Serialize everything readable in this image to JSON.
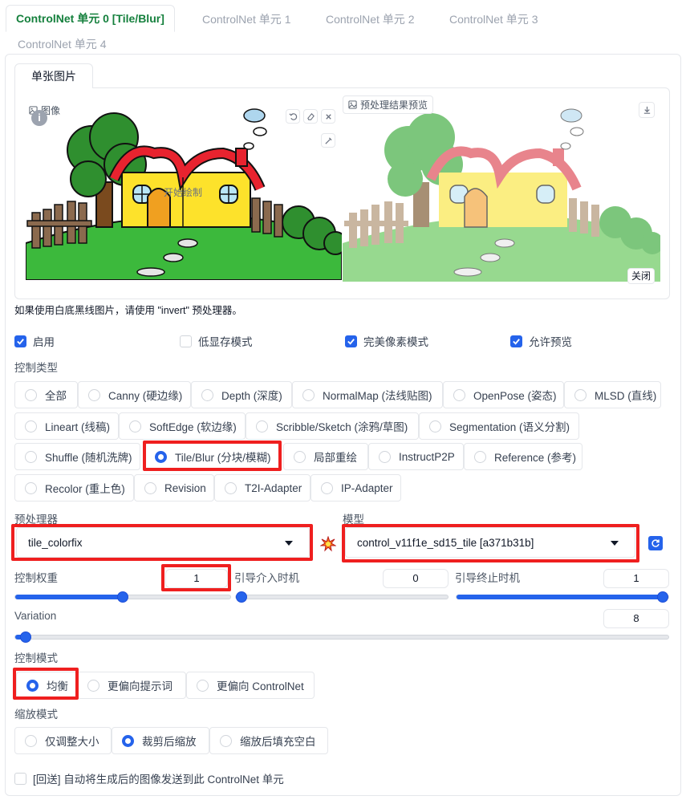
{
  "unit_tabs": [
    {
      "label": "ControlNet 单元 0 [Tile/Blur]",
      "active": true
    },
    {
      "label": "ControlNet 单元 1",
      "active": false
    },
    {
      "label": "ControlNet 单元 2",
      "active": false
    },
    {
      "label": "ControlNet 单元 3",
      "active": false
    },
    {
      "label": "ControlNet 单元 4",
      "active": false
    }
  ],
  "image_tab": "单张图片",
  "image_panel": {
    "input_label": "图像",
    "overlay_text": "开始绘制",
    "preview_label": "预处理结果预览",
    "close_label": "关闭"
  },
  "hint": "如果使用白底黑线图片，请使用 \"invert\" 预处理器。",
  "checkboxes": [
    {
      "label": "启用",
      "checked": true
    },
    {
      "label": "低显存模式",
      "checked": false
    },
    {
      "label": "完美像素模式",
      "checked": true
    },
    {
      "label": "允许预览",
      "checked": true
    }
  ],
  "control_type": {
    "label": "控制类型",
    "options": [
      {
        "label": "全部",
        "selected": false
      },
      {
        "label": "Canny (硬边缘)",
        "selected": false
      },
      {
        "label": "Depth (深度)",
        "selected": false
      },
      {
        "label": "NormalMap (法线贴图)",
        "selected": false
      },
      {
        "label": "OpenPose (姿态)",
        "selected": false
      },
      {
        "label": "MLSD (直线)",
        "selected": false
      },
      {
        "label": "Lineart (线稿)",
        "selected": false
      },
      {
        "label": "SoftEdge (软边缘)",
        "selected": false
      },
      {
        "label": "Scribble/Sketch (涂鸦/草图)",
        "selected": false
      },
      {
        "label": "Segmentation (语义分割)",
        "selected": false
      },
      {
        "label": "Shuffle (随机洗牌)",
        "selected": false
      },
      {
        "label": "Tile/Blur (分块/模糊)",
        "selected": true
      },
      {
        "label": "局部重绘",
        "selected": false
      },
      {
        "label": "InstructP2P",
        "selected": false
      },
      {
        "label": "Reference (参考)",
        "selected": false
      },
      {
        "label": "Recolor (重上色)",
        "selected": false
      },
      {
        "label": "Revision",
        "selected": false
      },
      {
        "label": "T2I-Adapter",
        "selected": false
      },
      {
        "label": "IP-Adapter",
        "selected": false
      }
    ]
  },
  "preprocessor": {
    "label": "预处理器",
    "value": "tile_colorfix"
  },
  "model": {
    "label": "模型",
    "value": "control_v11f1e_sd15_tile [a371b31b]"
  },
  "sliders": {
    "weight": {
      "label": "控制权重",
      "value": "1",
      "min": 0,
      "max": 2
    },
    "start": {
      "label": "引导介入时机",
      "value": "0",
      "min": 0,
      "max": 1
    },
    "end": {
      "label": "引导终止时机",
      "value": "1",
      "min": 0,
      "max": 1
    },
    "variation": {
      "label": "Variation",
      "value": "8",
      "min": 0,
      "max": 1000
    }
  },
  "control_mode": {
    "label": "控制模式",
    "options": [
      {
        "label": "均衡",
        "selected": true
      },
      {
        "label": "更偏向提示词",
        "selected": false
      },
      {
        "label": "更偏向 ControlNet",
        "selected": false
      }
    ]
  },
  "resize_mode": {
    "label": "缩放模式",
    "options": [
      {
        "label": "仅调整大小",
        "selected": false
      },
      {
        "label": "裁剪后缩放",
        "selected": true
      },
      {
        "label": "缩放后填充空白",
        "selected": false
      }
    ]
  },
  "loopback": {
    "label": "[回送] 自动将生成后的图像发送到此 ControlNet 单元",
    "checked": false
  },
  "colors": {
    "accent": "#2563eb",
    "active_tab": "#15803d",
    "highlight": "#ef1f1f"
  }
}
